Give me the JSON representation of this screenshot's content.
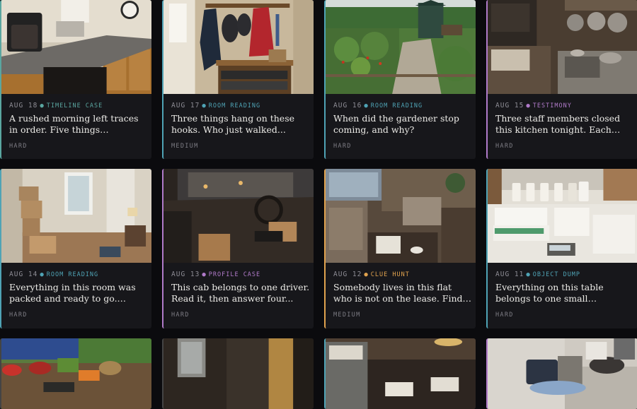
{
  "cards": [
    {
      "date": "AUG 18",
      "type": "TIMELINE CASE",
      "title": "A rushed morning left traces in order. Five things happened...",
      "difficulty": "HARD",
      "accent": "#5aa6a0",
      "scene": "kitchen"
    },
    {
      "date": "AUG 17",
      "type": "ROOM READING",
      "title": "Three things hang on these hooks. Who just walked...",
      "difficulty": "MEDIUM",
      "accent": "#4fa3b5",
      "scene": "hallway"
    },
    {
      "date": "AUG 16",
      "type": "ROOM READING",
      "title": "When did the gardener stop coming, and why?",
      "difficulty": "HARD",
      "accent": "#4fa3b5",
      "scene": "garden"
    },
    {
      "date": "AUG 15",
      "type": "TESTIMONY",
      "title": "Three staff members closed this kitchen tonight. Each tell...",
      "difficulty": "HARD",
      "accent": "#b07ac9",
      "scene": "restaurant-kitchen"
    },
    {
      "date": "AUG 14",
      "type": "ROOM READING",
      "title": "Everything in this room was packed and ready to go. Wha...",
      "difficulty": "HARD",
      "accent": "#4fa3b5",
      "scene": "moving-room"
    },
    {
      "date": "AUG 13",
      "type": "PROFILE CASE",
      "title": "This cab belongs to one driver. Read it, then answer four...",
      "difficulty": "HARD",
      "accent": "#b07ac9",
      "scene": "cab"
    },
    {
      "date": "AUG 12",
      "type": "CLUE HUNT",
      "title": "Somebody lives in this flat who is not on the lease. Find the...",
      "difficulty": "MEDIUM",
      "accent": "#e0a24e",
      "scene": "flat"
    },
    {
      "date": "AUG 11",
      "type": "OBJECT DUMP",
      "title": "Everything on this table belongs to one small venture....",
      "difficulty": "HARD",
      "accent": "#4fa3b5",
      "scene": "table"
    },
    {
      "scene": "market",
      "accent": "#444"
    },
    {
      "scene": "dark-room",
      "accent": "#444"
    },
    {
      "scene": "study",
      "accent": "#4fa3b5"
    },
    {
      "scene": "bed-bag",
      "accent": "#b07ac9"
    }
  ]
}
